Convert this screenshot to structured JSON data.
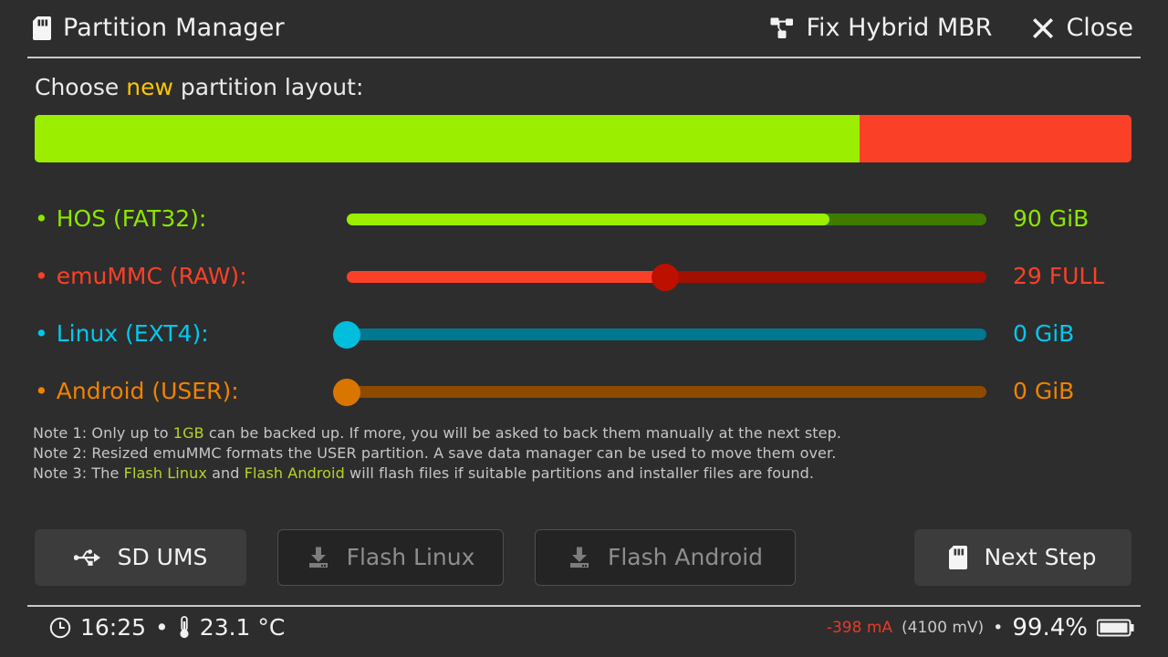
{
  "header": {
    "title": "Partition Manager",
    "title_icon": "sd-card-icon",
    "actions": [
      {
        "label": "Fix Hybrid MBR",
        "icon": "sitemap-icon"
      },
      {
        "label": "Close",
        "icon": "close-icon"
      }
    ]
  },
  "choose": {
    "prefix": "Choose ",
    "highlight": "new",
    "suffix": " partition layout:",
    "highlight_color": "#ffc400"
  },
  "layout_bar": {
    "segments": [
      {
        "name": "hos",
        "color": "#9bee00",
        "percent": 75.2
      },
      {
        "name": "emummc",
        "color": "#fb4028",
        "percent": 24.8
      }
    ]
  },
  "partitions": [
    {
      "name": "hos",
      "bullet": "•",
      "label": "HOS (FAT32):",
      "value": "90 GiB",
      "color": "#8ce600",
      "fill_color": "#9bee00",
      "track_color": "#3e7b00",
      "knob_color": "#6fb400",
      "percent": 75.5,
      "show_knob": false
    },
    {
      "name": "emummc",
      "bullet": "•",
      "label": "emuMMC (RAW):",
      "value": "29 FULL",
      "color": "#fb4028",
      "fill_color": "#fb4028",
      "track_color": "#a11000",
      "knob_color": "#bd1000",
      "percent": 49.8,
      "show_knob": true
    },
    {
      "name": "linux",
      "bullet": "•",
      "label": "Linux (EXT4):",
      "value": "0 GiB",
      "color": "#00c8f0",
      "fill_color": "#00b4dc",
      "track_color": "#00788f",
      "knob_color": "#00bedc",
      "percent": 0,
      "show_knob": true
    },
    {
      "name": "android",
      "bullet": "•",
      "label": "Android (USER):",
      "value": "0 GiB",
      "color": "#f08200",
      "fill_color": "#d97600",
      "track_color": "#8e4b00",
      "knob_color": "#d97600",
      "percent": 0,
      "show_knob": true
    }
  ],
  "notes": [
    {
      "parts": [
        {
          "text": "Note 1: Only up to ",
          "hl": false
        },
        {
          "text": "1GB",
          "hl": true
        },
        {
          "text": " can be backed up. If more, you will be asked to back them manually at the next step.",
          "hl": false
        }
      ]
    },
    {
      "parts": [
        {
          "text": "Note 2: Resized emuMMC formats the USER partition. A save data manager can be used to move them over.",
          "hl": false
        }
      ]
    },
    {
      "parts": [
        {
          "text": "Note 3: The ",
          "hl": false
        },
        {
          "text": "Flash Linux",
          "hl": true
        },
        {
          "text": " and ",
          "hl": false
        },
        {
          "text": "Flash Android",
          "hl": true
        },
        {
          "text": " will flash files if suitable partitions and installer files are found.",
          "hl": false
        }
      ]
    }
  ],
  "buttons": [
    {
      "id": "sd-ums",
      "label": "SD UMS",
      "icon": "usb-icon",
      "enabled": true
    },
    {
      "id": "flash-linux",
      "label": "Flash Linux",
      "icon": "download-icon",
      "enabled": false
    },
    {
      "id": "flash-android",
      "label": "Flash Android",
      "icon": "download-icon",
      "enabled": false
    },
    {
      "id": "next-step",
      "label": "Next Step",
      "icon": "sd-card-icon",
      "enabled": true
    }
  ],
  "status": {
    "clock_icon": "clock-icon",
    "time": "16:25",
    "separator": "•",
    "temp_icon": "thermometer-icon",
    "temperature": "23.1 °C",
    "current": "-398 mA",
    "voltage": "(4100 mV)",
    "battery_percent": "99.4%",
    "battery_icon": "battery-icon",
    "current_color": "#e8392a"
  }
}
